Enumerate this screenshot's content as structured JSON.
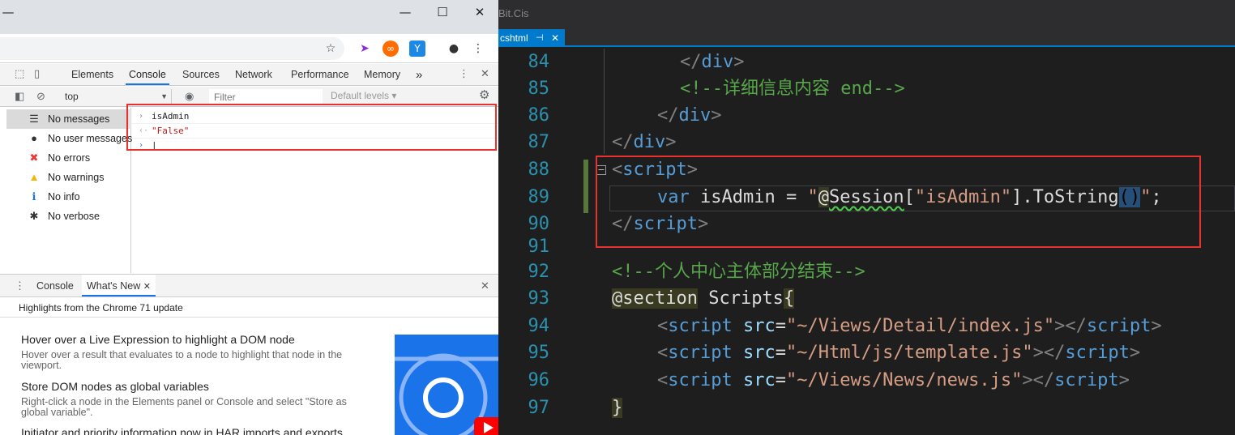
{
  "chrome": {
    "window_controls": {
      "minimize": "—",
      "maximize": "☐",
      "close": "✕"
    }
  },
  "devtools": {
    "tabs": [
      {
        "label": "Elements",
        "active": false
      },
      {
        "label": "Console",
        "active": true
      },
      {
        "label": "Sources",
        "active": false
      },
      {
        "label": "Network",
        "active": false
      },
      {
        "label": "Performance",
        "active": false
      },
      {
        "label": "Memory",
        "active": false
      }
    ],
    "more_tabs": "»",
    "toolbar": {
      "context": "top",
      "filter_placeholder": "Filter",
      "levels": "Default levels ▾"
    },
    "sidebar": [
      {
        "icon": "list-icon",
        "glyph": "☰",
        "label": "No messages",
        "selected": true
      },
      {
        "icon": "user-icon",
        "glyph": "●",
        "label": "No user messages",
        "selected": false
      },
      {
        "icon": "error-icon",
        "glyph": "✖",
        "label": "No errors",
        "selected": false
      },
      {
        "icon": "warning-icon",
        "glyph": "▲",
        "label": "No warnings",
        "selected": false
      },
      {
        "icon": "info-icon",
        "glyph": "ℹ",
        "label": "No info",
        "selected": false
      },
      {
        "icon": "verbose-icon",
        "glyph": "✱",
        "label": "No verbose",
        "selected": false
      }
    ],
    "console": {
      "input_line": "isAdmin",
      "result_line": "\"False\""
    },
    "drawer": {
      "tabs": [
        {
          "label": "Console",
          "active": false
        },
        {
          "label": "What's New",
          "active": true
        }
      ],
      "banner": "Highlights from the Chrome 71 update",
      "items": [
        {
          "title": "Hover over a Live Expression to highlight a DOM node",
          "desc": "Hover over a result that evaluates to a node to highlight that node in the viewport."
        },
        {
          "title": "Store DOM nodes as global variables",
          "desc": "Right-click a node in the Elements panel or Console and select \"Store as global variable\"."
        },
        {
          "title": "Initiator and priority information now in HAR imports and exports",
          "desc": ""
        }
      ]
    }
  },
  "editor": {
    "title": "Bit.Cis",
    "tab": {
      "label": "cshtml",
      "pin": "⊣",
      "close": "✕"
    },
    "lines": [
      {
        "num": "84",
        "indent": 3,
        "tokens": [
          [
            "tagp",
            "</"
          ],
          [
            "tag",
            "div"
          ],
          [
            "tagp",
            ">"
          ]
        ]
      },
      {
        "num": "85",
        "indent": 3,
        "tokens": [
          [
            "cmt",
            "<!--详细信息内容 end-->"
          ]
        ]
      },
      {
        "num": "86",
        "indent": 2,
        "tokens": [
          [
            "tagp",
            "</"
          ],
          [
            "tag",
            "div"
          ],
          [
            "tagp",
            ">"
          ]
        ]
      },
      {
        "num": "87",
        "indent": 0,
        "tokens": [
          [
            "tagp",
            "</"
          ],
          [
            "tag",
            "div"
          ],
          [
            "tagp",
            ">"
          ]
        ]
      },
      {
        "num": "88",
        "indent": 0,
        "tokens": [
          [
            "tagp",
            "<"
          ],
          [
            "tag",
            "script"
          ],
          [
            "tagp",
            ">"
          ]
        ]
      },
      {
        "num": "89",
        "indent": 2,
        "tokens": [
          [
            "kw",
            "var"
          ],
          [
            "id",
            " isAdmin = "
          ],
          [
            "str",
            "\""
          ],
          [
            "razor",
            "@"
          ],
          [
            "id",
            "Session"
          ],
          [
            "id",
            "["
          ],
          [
            "str",
            "\"isAdmin\""
          ],
          [
            "id",
            "].ToString"
          ],
          [
            "hl",
            "()"
          ],
          [
            "str",
            "\""
          ],
          [
            "id",
            ";"
          ]
        ]
      },
      {
        "num": "90",
        "indent": 0,
        "tokens": [
          [
            "tagp",
            "</"
          ],
          [
            "tag",
            "script"
          ],
          [
            "tagp",
            ">"
          ]
        ]
      },
      {
        "num": "91",
        "indent": 0,
        "tokens": []
      },
      {
        "num": "92",
        "indent": 0,
        "tokens": [
          [
            "cmt",
            "<!--个人中心主体部分结束-->"
          ]
        ]
      },
      {
        "num": "93",
        "indent": 0,
        "tokens": [
          [
            "razor",
            "@section"
          ],
          [
            "id",
            " Scripts"
          ],
          [
            "razor",
            "{"
          ]
        ]
      },
      {
        "num": "94",
        "indent": 2,
        "tokens": [
          [
            "tagp",
            "<"
          ],
          [
            "tag",
            "script"
          ],
          [
            "attr",
            " src"
          ],
          [
            "id",
            "="
          ],
          [
            "str",
            "\"~/Views/Detail/index.js\""
          ],
          [
            "tagp",
            "></"
          ],
          [
            "tag",
            "script"
          ],
          [
            "tagp",
            ">"
          ]
        ]
      },
      {
        "num": "95",
        "indent": 2,
        "tokens": [
          [
            "tagp",
            "<"
          ],
          [
            "tag",
            "script"
          ],
          [
            "attr",
            " src"
          ],
          [
            "id",
            "="
          ],
          [
            "str",
            "\"~/Html/js/template.js\""
          ],
          [
            "tagp",
            "></"
          ],
          [
            "tag",
            "script"
          ],
          [
            "tagp",
            ">"
          ]
        ]
      },
      {
        "num": "96",
        "indent": 2,
        "tokens": [
          [
            "tagp",
            "<"
          ],
          [
            "tag",
            "script"
          ],
          [
            "attr",
            " src"
          ],
          [
            "id",
            "="
          ],
          [
            "str",
            "\"~/Views/News/news.js\""
          ],
          [
            "tagp",
            "></"
          ],
          [
            "tag",
            "script"
          ],
          [
            "tagp",
            ">"
          ]
        ]
      },
      {
        "num": "97",
        "indent": 0,
        "tokens": [
          [
            "razor",
            "}"
          ]
        ]
      }
    ]
  }
}
